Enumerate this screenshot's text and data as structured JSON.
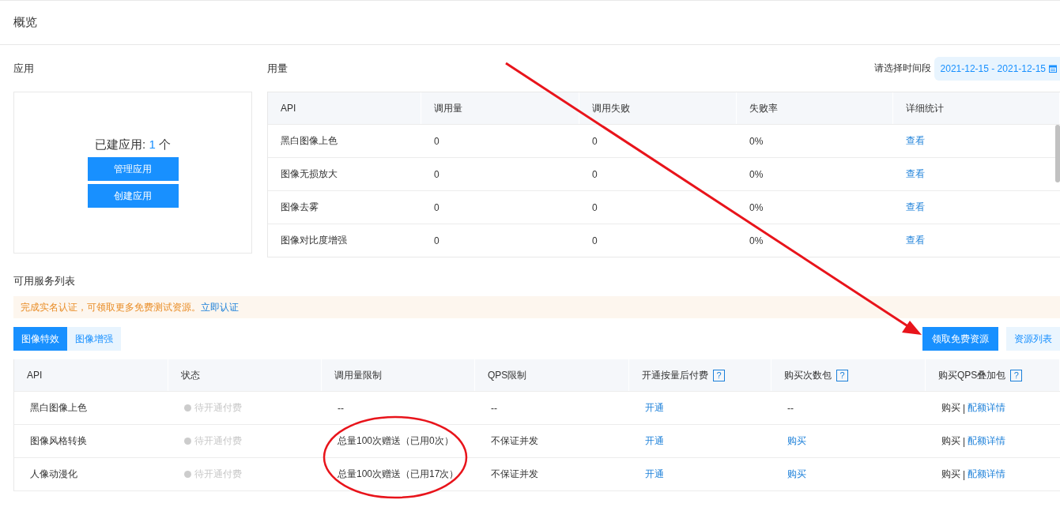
{
  "page": {
    "title": "概览"
  },
  "apps": {
    "title": "应用",
    "count_label": "已建应用: ",
    "count": "1",
    "count_unit": " 个",
    "buttons": [
      "管理应用",
      "创建应用"
    ]
  },
  "usage": {
    "title": "用量",
    "date_label": "请选择时间段",
    "date_range": "2021-12-15 - 2021-12-15",
    "columns": [
      "API",
      "调用量",
      "调用失败",
      "失败率",
      "详细统计"
    ],
    "rows": [
      {
        "cells": [
          "黑白图像上色",
          "0",
          "0",
          "0%"
        ],
        "link": "查看"
      },
      {
        "cells": [
          "图像无损放大",
          "0",
          "0",
          "0%"
        ],
        "link": "查看"
      },
      {
        "cells": [
          "图像去雾",
          "0",
          "0",
          "0%"
        ],
        "link": "查看"
      },
      {
        "cells": [
          "图像对比度增强",
          "0",
          "0",
          "0%"
        ],
        "link": "查看"
      }
    ]
  },
  "services": {
    "title": "可用服务列表",
    "notice": {
      "text": "完成实名认证，可领取更多免费测试资源。",
      "link": "立即认证"
    },
    "tabs": [
      {
        "label": "图像特效",
        "selected": true
      },
      {
        "label": "图像增强",
        "selected": false
      }
    ],
    "actions": [
      {
        "label": "领取免费资源",
        "kind": "primary"
      },
      {
        "label": "资源列表",
        "kind": "light"
      }
    ],
    "columns": [
      {
        "label": "API"
      },
      {
        "label": "状态"
      },
      {
        "label": "调用量限制"
      },
      {
        "label": "QPS限制"
      },
      {
        "label": "开通按量后付费",
        "help_mark": "?"
      },
      {
        "label": "购买次数包",
        "help_mark": "?"
      },
      {
        "label": "购买QPS叠加包",
        "help_mark": "?"
      }
    ],
    "rows": [
      {
        "cells": [
          {
            "kind": "text",
            "text": "黑白图像上色"
          },
          {
            "kind": "status",
            "text": "待开通付费"
          },
          {
            "kind": "text",
            "text": "--"
          },
          {
            "kind": "text",
            "text": "--"
          },
          {
            "kind": "link",
            "text": "开通"
          },
          {
            "kind": "text",
            "text": "--"
          },
          {
            "kind": "split",
            "text": "购买",
            "separator": "|",
            "link": "配额详情"
          }
        ]
      },
      {
        "cells": [
          {
            "kind": "text",
            "text": "图像风格转换"
          },
          {
            "kind": "status",
            "text": "待开通付费"
          },
          {
            "kind": "text",
            "text": "总量100次赠送（已用0次）"
          },
          {
            "kind": "text",
            "text": "不保证并发"
          },
          {
            "kind": "link",
            "text": "开通"
          },
          {
            "kind": "link",
            "text": "购买"
          },
          {
            "kind": "split",
            "text": "购买",
            "separator": "|",
            "link": "配额详情"
          }
        ]
      },
      {
        "cells": [
          {
            "kind": "text",
            "text": "人像动漫化"
          },
          {
            "kind": "status",
            "text": "待开通付费"
          },
          {
            "kind": "text",
            "text": "总量100次赠送（已用17次）"
          },
          {
            "kind": "text",
            "text": "不保证并发"
          },
          {
            "kind": "link",
            "text": "开通"
          },
          {
            "kind": "link",
            "text": "购买"
          },
          {
            "kind": "split",
            "text": "购买",
            "separator": "|",
            "link": "配额详情"
          }
        ]
      }
    ]
  }
}
